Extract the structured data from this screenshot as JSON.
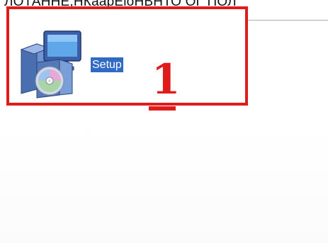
{
  "header": {
    "cut_text": "ЛОТАННЕ,НКаарЕіоНВНТО ОГ ПОЛ"
  },
  "file_item": {
    "label": "Setup",
    "icon": "setup-installer-icon",
    "selected": true
  },
  "annotation": {
    "number": "1",
    "color": "#e01b1b"
  },
  "colors": {
    "selection_bg": "#316ac5",
    "selection_text": "#ffffff",
    "highlight_border": "#e01b1b",
    "divider": "#a8acc2"
  }
}
